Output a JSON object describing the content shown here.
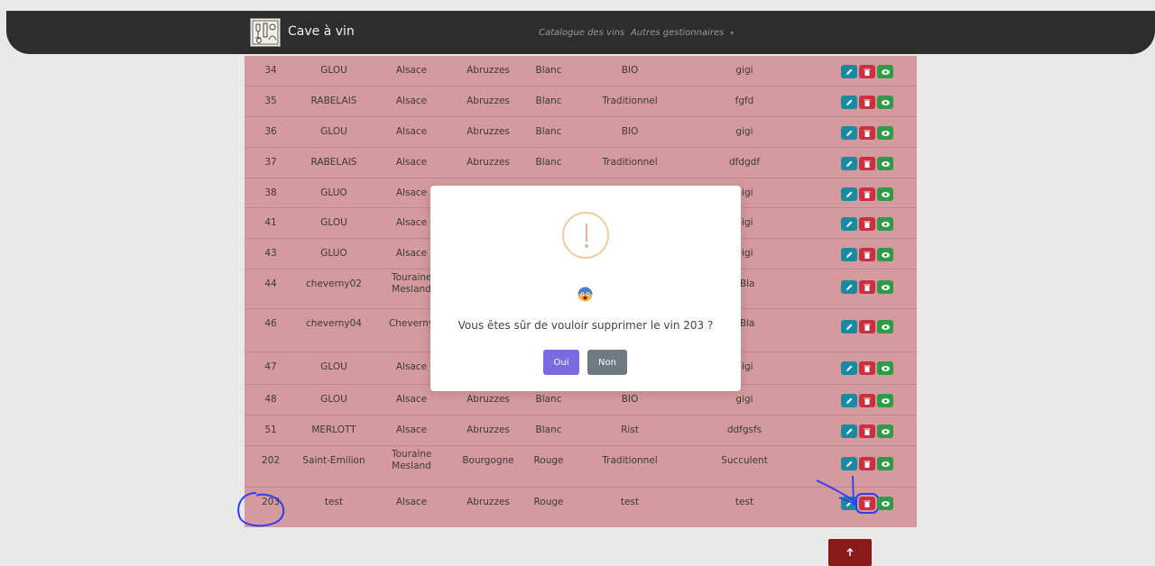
{
  "app": {
    "title": "Cave à vin"
  },
  "nav": [
    {
      "label": "Catalogue des vins"
    },
    {
      "label": "Autres gestionnaires",
      "icon": "caret-down-icon"
    }
  ],
  "table": {
    "rows": [
      {
        "id": "34",
        "name": "GLOU",
        "region1": "Alsace",
        "region2": "Abruzzes",
        "color": "Blanc",
        "type": "BIO",
        "desc": "gigi"
      },
      {
        "id": "35",
        "name": "RABELAIS",
        "region1": "Alsace",
        "region2": "Abruzzes",
        "color": "Blanc",
        "type": "Traditionnel",
        "desc": "fgfd"
      },
      {
        "id": "36",
        "name": "GLOU",
        "region1": "Alsace",
        "region2": "Abruzzes",
        "color": "Blanc",
        "type": "BIO",
        "desc": "gigi"
      },
      {
        "id": "37",
        "name": "RABELAIS",
        "region1": "Alsace",
        "region2": "Abruzzes",
        "color": "Blanc",
        "type": "Traditionnel",
        "desc": "dfdgdf"
      },
      {
        "id": "38",
        "name": "GLUO",
        "region1": "Alsace",
        "region2": "",
        "color": "",
        "type": "",
        "desc": "gigi"
      },
      {
        "id": "41",
        "name": "GLOU",
        "region1": "Alsace",
        "region2": "",
        "color": "",
        "type": "",
        "desc": "gigi"
      },
      {
        "id": "43",
        "name": "GLUO",
        "region1": "Alsace",
        "region2": "",
        "color": "",
        "type": "",
        "desc": "gigi"
      },
      {
        "id": "44",
        "name": "cheverny02",
        "region1": "Touraine Mesland",
        "region2": "",
        "color": "",
        "type": "",
        "desc": "aBla"
      },
      {
        "id": "46",
        "name": "cheverny04",
        "region1": "Cheverny",
        "region2": "",
        "color": "",
        "type": "",
        "desc": "aBla"
      },
      {
        "id": "47",
        "name": "GLOU",
        "region1": "Alsace",
        "region2": "",
        "color": "",
        "type": "",
        "desc": "gigi"
      },
      {
        "id": "48",
        "name": "GLOU",
        "region1": "Alsace",
        "region2": "Abruzzes",
        "color": "Blanc",
        "type": "BIO",
        "desc": "gigi"
      },
      {
        "id": "51",
        "name": "MERLOTT",
        "region1": "Alsace",
        "region2": "Abruzzes",
        "color": "Blanc",
        "type": "Rist",
        "desc": "ddfgsfs"
      },
      {
        "id": "202",
        "name": "Saint-Emilion",
        "region1": "Touraine Mesland",
        "region2": "Bourgogne",
        "color": "Rouge",
        "type": "Traditionnel",
        "desc": "Succulent"
      },
      {
        "id": "203",
        "name": "test",
        "region1": "Alsace",
        "region2": "Abruzzes",
        "color": "Rouge",
        "type": "test",
        "desc": "test"
      }
    ],
    "actions": {
      "edit_icon": "pencil-icon",
      "delete_icon": "trash-icon",
      "view_icon": "eye-icon"
    }
  },
  "scroll_top": {
    "icon": "arrow-up-icon"
  },
  "modal": {
    "icon": "warning-icon",
    "emoji": "scared-face-emoji",
    "message": "Vous êtes sûr de vouloir supprimer le vin 203 ?",
    "confirm_label": "Oui",
    "cancel_label": "Non"
  },
  "colors": {
    "table_bg": "#d59a9e",
    "navbar_bg": "#2d2d2d",
    "confirm_btn": "#7a6be0",
    "cancel_btn": "#6f7b82",
    "edit_btn": "#1a8aa0",
    "delete_btn": "#c93040",
    "view_btn": "#2f9a48",
    "annotation": "#2f3df0"
  }
}
